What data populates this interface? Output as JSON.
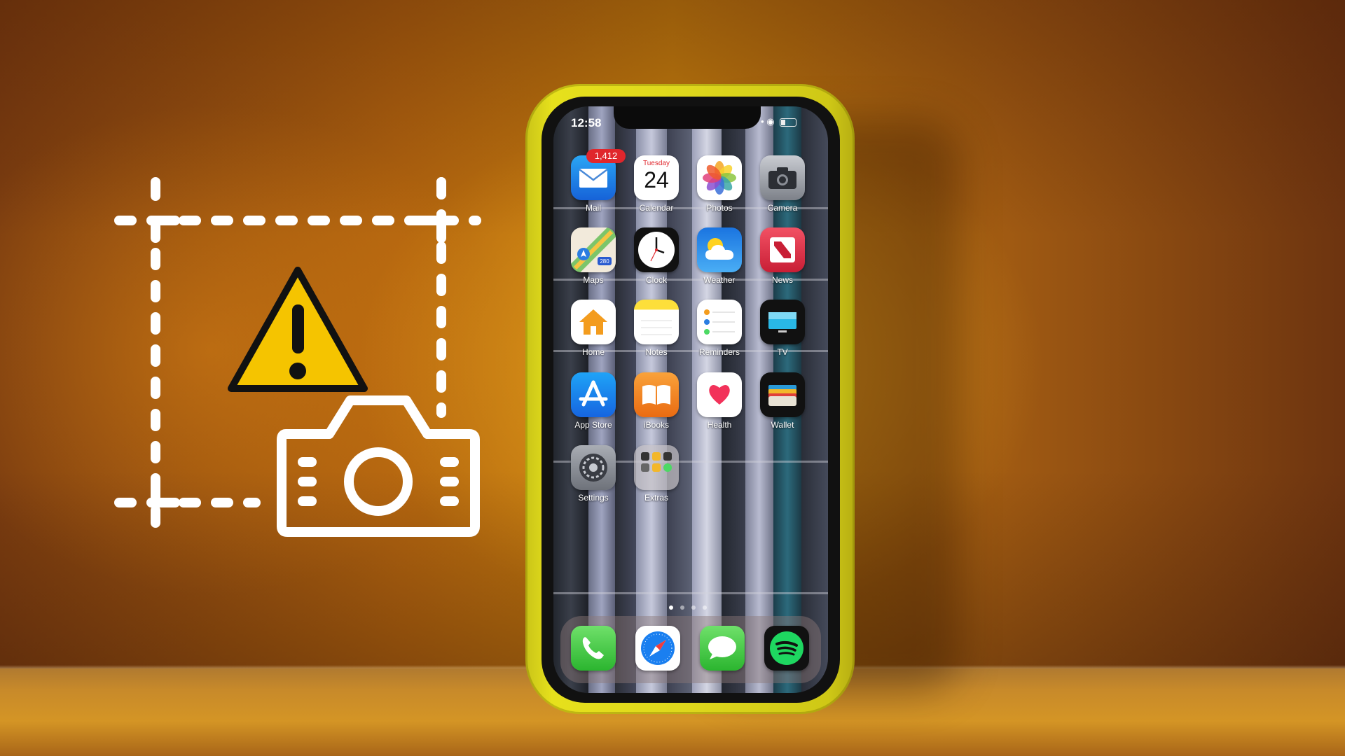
{
  "status_bar": {
    "time": "12:58"
  },
  "badges": {
    "mail": "1,412"
  },
  "calendar_icon": {
    "weekday": "Tuesday",
    "day": "24"
  },
  "apps": {
    "mail": "Mail",
    "calendar": "Calendar",
    "photos": "Photos",
    "camera": "Camera",
    "maps": "Maps",
    "clock": "Clock",
    "weather": "Weather",
    "news": "News",
    "home": "Home",
    "notes": "Notes",
    "reminders": "Reminders",
    "tv": "TV",
    "app_store": "App Store",
    "ibooks": "iBooks",
    "health": "Health",
    "wallet": "Wallet",
    "settings": "Settings",
    "extras": "Extras"
  },
  "dock": [
    "phone-icon",
    "safari-icon",
    "messages-icon",
    "spotify-icon"
  ],
  "maps_icon": {
    "route": "280"
  },
  "page_indicator": {
    "pages": 4,
    "current": 1
  },
  "colors": {
    "case": "#e3dc1c",
    "warning": "#f5c400",
    "wall": "#c9820e"
  },
  "overlay_icons": [
    "screenshot-frame-icon",
    "warning-icon",
    "camera-icon"
  ]
}
